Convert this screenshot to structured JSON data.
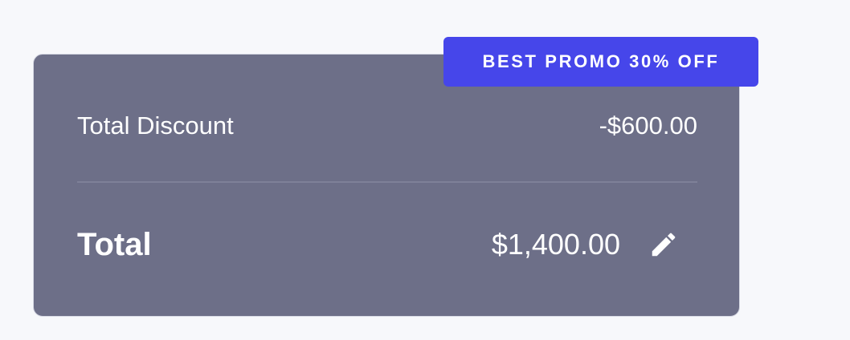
{
  "promo": {
    "label": "BEST PROMO 30% OFF"
  },
  "summary": {
    "discount_label": "Total Discount",
    "discount_value": "-$600.00",
    "total_label": "Total",
    "total_value": "$1,400.00"
  },
  "icons": {
    "edit": "pencil-icon"
  },
  "colors": {
    "page_background": "#f7f8fb",
    "card_background": "#6d6f88",
    "badge_background": "#4646ea",
    "text": "#ffffff"
  }
}
